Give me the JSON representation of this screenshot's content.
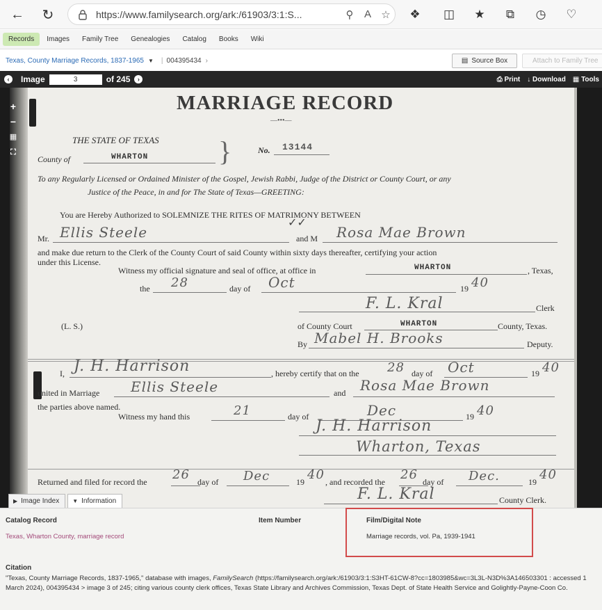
{
  "browser": {
    "url": "https://www.familysearch.org/ark:/61903/3:1:S..."
  },
  "fs_nav": {
    "items": [
      "Records",
      "Images",
      "Family Tree",
      "Genealogies",
      "Catalog",
      "Books",
      "Wiki"
    ]
  },
  "crumbs": {
    "collection": "Texas, County Marriage Records, 1837-1965",
    "film_number": "004395434",
    "source_box": "Source Box",
    "attach": "Attach to Family Tree"
  },
  "viewer": {
    "image_label": "Image",
    "image_number": "3",
    "of_total": "of 245",
    "print": "Print",
    "download": "Download",
    "tools": "Tools"
  },
  "document": {
    "title": "MARRIAGE RECORD",
    "state": "THE STATE OF TEXAS",
    "county_of": "County of",
    "county_name": "WHARTON",
    "no_label": "No.",
    "no_value": "13144",
    "address_line1": "To any Regularly Licensed or Ordained Minister of the Gospel, Jewish Rabbi, Judge of the District or County Court, or any",
    "address_line2": "Justice of the Peace, in and for The State of Texas—GREETING:",
    "authorized": "You are Hereby Authorized to SOLEMNIZE THE RITES OF MATRIMONY BETWEEN",
    "mr": "Mr.",
    "groom": "Ellis Steele",
    "and_m": "and M",
    "bride": "Rosa Mae Brown",
    "return_line1": "and make due return to the Clerk of the County Court of said County within sixty days thereafter, certifying your action",
    "return_line2": "under this License.",
    "witness1": "Witness my official signature and seal of office, at office in",
    "office_in": "WHARTON",
    "texas": ", Texas,",
    "the": "the",
    "day1": "28",
    "day_of": "day of",
    "month1": "Oct",
    "year_prefix": "19",
    "year1": "40",
    "clerk_sig": "F. L. Kral",
    "clerk": "Clerk",
    "ls": "(L. S.)",
    "of_county_court": "of County Court",
    "county_court_name": "WHARTON",
    "county_texas": "County, Texas.",
    "by": "By",
    "deputy_sig": "Mabel H. Brooks",
    "deputy": "Deputy.",
    "i": "I,",
    "officiant": "J. H. Harrison",
    "certify": ", hereby certify that on the",
    "day2": "28",
    "day_of2": "day of",
    "month2": "Oct",
    "year2": "40",
    "united": "united in Marriage",
    "groom2": "Ellis Steele",
    "and": "and",
    "bride2": "Rosa Mae Brown",
    "parties": "the parties above named.",
    "witness2": "Witness my hand this",
    "day3": "21",
    "day_of3": "day of",
    "month3": "Dec",
    "year3": "40",
    "off_sig": "J. H. Harrison",
    "off_place": "Wharton, Texas",
    "returned": "Returned and filed for record the",
    "day4": "26",
    "day_of4": "day of",
    "month4": "Dec",
    "year4": "40",
    "recorded": ", and recorded the",
    "day5": "26",
    "day_of5": "day of",
    "month5": "Dec.",
    "year5": "40",
    "clerk2_sig": "F. L. Kral",
    "county_clerk": "County Clerk."
  },
  "tabs": [
    "Image Index",
    "Information"
  ],
  "info": {
    "catalog_record_label": "Catalog Record",
    "catalog_record_value": "Texas, Wharton County, marriage record",
    "item_number_label": "Item Number",
    "film_note_label": "Film/Digital Note",
    "film_note_value": "Marriage records, vol. Pa, 1939-1941",
    "citation_label": "Citation",
    "citation_pre": "\"Texas, County Marriage Records, 1837-1965,\" database with images, ",
    "citation_italic": "FamilySearch",
    "citation_post": " (https://familysearch.org/ark:/61903/3:1:S3HT-61CW-8?cc=1803985&wc=3L3L-N3D%3A146503301 : accessed 1 March 2024), 004395434 > image 3 of 245; citing various county clerk offices, Texas State Library and Archives Commission, Texas Dept. of State Health Service and Golightly-Payne-Coon Co."
  },
  "colors": {
    "highlight_box": "#d24b4b",
    "records_tab_active": "#cde9b3",
    "link_blue": "#2a6ab5",
    "catalog_link": "#a34a7a"
  }
}
